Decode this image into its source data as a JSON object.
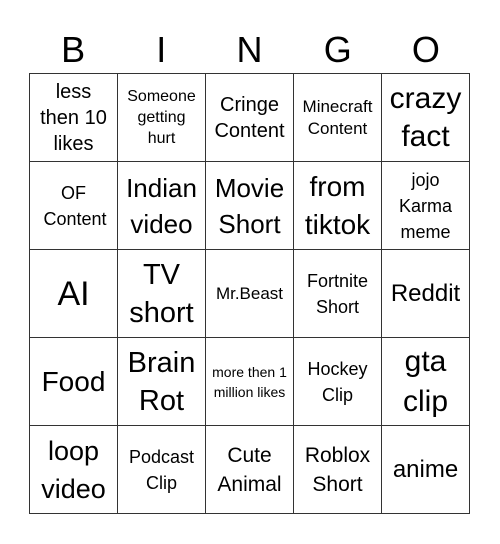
{
  "header": {
    "letters": [
      "B",
      "I",
      "N",
      "G",
      "O"
    ]
  },
  "cells": [
    [
      "less then 10 likes",
      "Someone getting hurt",
      "Cringe Content",
      "Minecraft Content",
      "crazy fact"
    ],
    [
      "OF Content",
      "Indian video",
      "Movie Short",
      "from tiktok",
      "jojo Karma meme"
    ],
    [
      "AI",
      "TV short",
      "Mr.Beast",
      "Fortnite Short",
      "Reddit"
    ],
    [
      "Food",
      "Brain Rot",
      "more then 1 million likes",
      "Hockey Clip",
      "gta clip"
    ],
    [
      "loop video",
      "Podcast Clip",
      "Cute Animal",
      "Roblox Short",
      "anime"
    ]
  ],
  "colors": {
    "grid_line": "#333333",
    "text": "#000000",
    "background": "#ffffff"
  }
}
